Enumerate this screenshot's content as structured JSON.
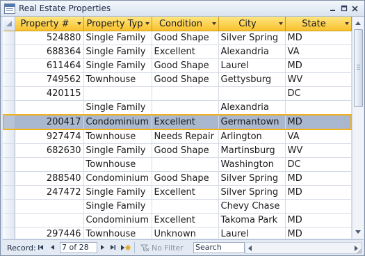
{
  "window": {
    "title": "Real Estate Properties"
  },
  "columns": [
    {
      "label": "Property #"
    },
    {
      "label": "Property Typ"
    },
    {
      "label": "Condition"
    },
    {
      "label": "City"
    },
    {
      "label": "State"
    }
  ],
  "rows": [
    {
      "id": "524880",
      "type": "Single Family",
      "condition": "Good Shape",
      "city": "Silver Spring",
      "state": "MD",
      "current": false
    },
    {
      "id": "688364",
      "type": "Single Family",
      "condition": "Excellent",
      "city": "Alexandria",
      "state": "VA",
      "current": false
    },
    {
      "id": "611464",
      "type": "Single Family",
      "condition": "Good Shape",
      "city": "Laurel",
      "state": "MD",
      "current": false
    },
    {
      "id": "749562",
      "type": "Townhouse",
      "condition": "Good Shape",
      "city": "Gettysburg",
      "state": "WV",
      "current": false
    },
    {
      "id": "420115",
      "type": "",
      "condition": "",
      "city": "",
      "state": "DC",
      "current": false
    },
    {
      "id": "",
      "type": "Single Family",
      "condition": "",
      "city": "Alexandria",
      "state": "",
      "current": false
    },
    {
      "id": "200417",
      "type": "Condominium",
      "condition": "Excellent",
      "city": "Germantown",
      "state": "MD",
      "current": true
    },
    {
      "id": "927474",
      "type": "Townhouse",
      "condition": "Needs Repair",
      "city": "Arlington",
      "state": "VA",
      "current": false
    },
    {
      "id": "682630",
      "type": "Single Family",
      "condition": "Good Shape",
      "city": "Martinsburg",
      "state": "WV",
      "current": false
    },
    {
      "id": "",
      "type": "Townhouse",
      "condition": "",
      "city": "Washington",
      "state": "DC",
      "current": false
    },
    {
      "id": "288540",
      "type": "Condominium",
      "condition": "Good Shape",
      "city": "Silver Spring",
      "state": "MD",
      "current": false
    },
    {
      "id": "247472",
      "type": "Single Family",
      "condition": "Excellent",
      "city": "Silver Spring",
      "state": "MD",
      "current": false
    },
    {
      "id": "",
      "type": "Single Family",
      "condition": "",
      "city": "Chevy Chase",
      "state": "",
      "current": false
    },
    {
      "id": "",
      "type": "Condominium",
      "condition": "Excellent",
      "city": "Takoma Park",
      "state": "MD",
      "current": false
    },
    {
      "id": "297446",
      "type": "Townhouse",
      "condition": "Unknown",
      "city": "Laurel",
      "state": "MD",
      "current": false
    }
  ],
  "navigation": {
    "record_label": "Record:",
    "record_position": "7 of 28",
    "filter_label": "No Filter",
    "search_placeholder": "Search"
  },
  "colors": {
    "header_gold": "#f9c12e",
    "current_row": "#a9b8cf",
    "current_border": "#f2b01e"
  }
}
